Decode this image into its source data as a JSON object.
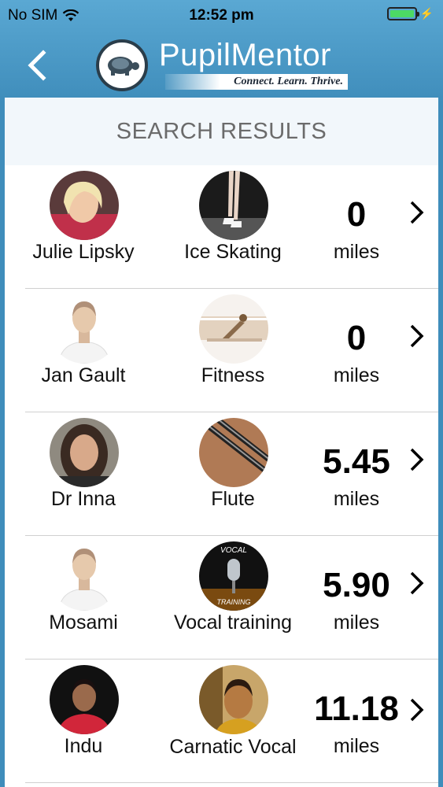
{
  "status_bar": {
    "carrier": "No SIM",
    "time": "12:52 pm",
    "wifi_icon": "wifi-icon",
    "battery_icon": "battery-full-icon",
    "battery_color": "#4cd964"
  },
  "header": {
    "back_icon": "chevron-left-icon",
    "logo_text_1": "Pupil",
    "logo_text_2": "Mentor",
    "logo_tagline": "Connect. Learn. Thrive.",
    "logo_icon": "turtle-icon",
    "bar_color": "#3f8dbb"
  },
  "panel": {
    "title": "SEARCH RESULTS"
  },
  "results": [
    {
      "mentor": "Julie Lipsky",
      "subject": "Ice Skating",
      "distance": "0",
      "unit": "miles",
      "mentor_avatar": "photo",
      "subject_image": "ice-skating"
    },
    {
      "mentor": "Jan Gault",
      "subject": "Fitness",
      "distance": "0",
      "unit": "miles",
      "mentor_avatar": "placeholder-person",
      "subject_image": "fitness"
    },
    {
      "mentor": "Dr Inna",
      "subject": "Flute",
      "distance": "5.45",
      "unit": "miles",
      "mentor_avatar": "photo",
      "subject_image": "flute"
    },
    {
      "mentor": "Mosami",
      "subject": "Vocal training",
      "distance": "5.90",
      "unit": "miles",
      "mentor_avatar": "placeholder-person",
      "subject_image": "vocal-training"
    },
    {
      "mentor": "Indu",
      "subject": "Carnatic Vocal",
      "distance": "11.18",
      "unit": "miles",
      "mentor_avatar": "photo",
      "subject_image": "carnatic-vocal"
    }
  ],
  "subject_badges": {
    "vocal_top": "VOCAL",
    "vocal_bottom": "TRAINING"
  }
}
